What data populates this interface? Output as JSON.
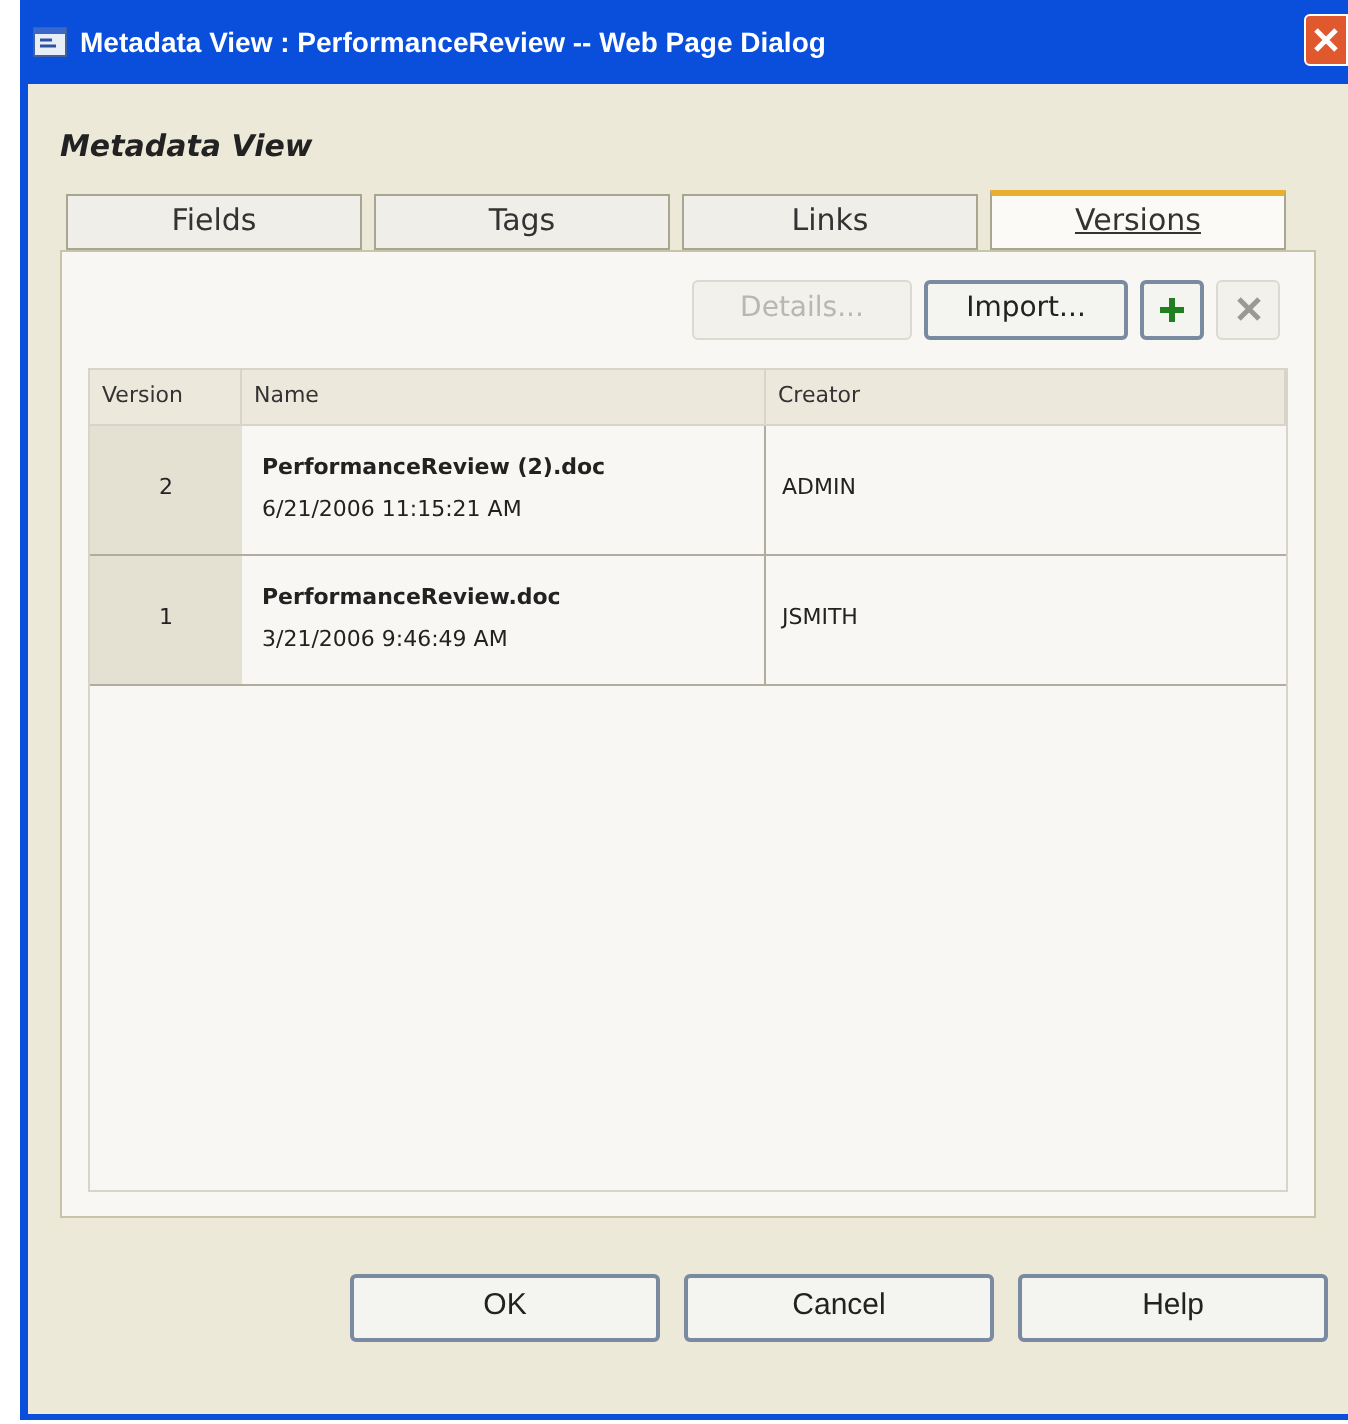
{
  "window": {
    "title": "Metadata View : PerformanceReview -- Web Page Dialog"
  },
  "heading": "Metadata View",
  "tabs": [
    {
      "label": "Fields",
      "selected": false
    },
    {
      "label": "Tags",
      "selected": false
    },
    {
      "label": "Links",
      "selected": false
    },
    {
      "label": "Versions",
      "selected": true
    }
  ],
  "toolbar": [
    {
      "kind": "text",
      "label": "Details...",
      "disabled": true
    },
    {
      "kind": "text",
      "label": "Import...",
      "disabled": false
    },
    {
      "kind": "add",
      "disabled": false
    },
    {
      "kind": "delete",
      "disabled": true
    }
  ],
  "table": {
    "columns": [
      "Version",
      "Name",
      "Creator"
    ],
    "rows": [
      {
        "version": "2",
        "name": "PerformanceReview (2).doc",
        "date": "6/21/2006 11:15:21 AM",
        "creator": "ADMIN"
      },
      {
        "version": "1",
        "name": "PerformanceReview.doc",
        "date": "3/21/2006 9:46:49 AM",
        "creator": "JSMITH"
      }
    ]
  },
  "buttons": [
    "OK",
    "Cancel",
    "Help"
  ]
}
